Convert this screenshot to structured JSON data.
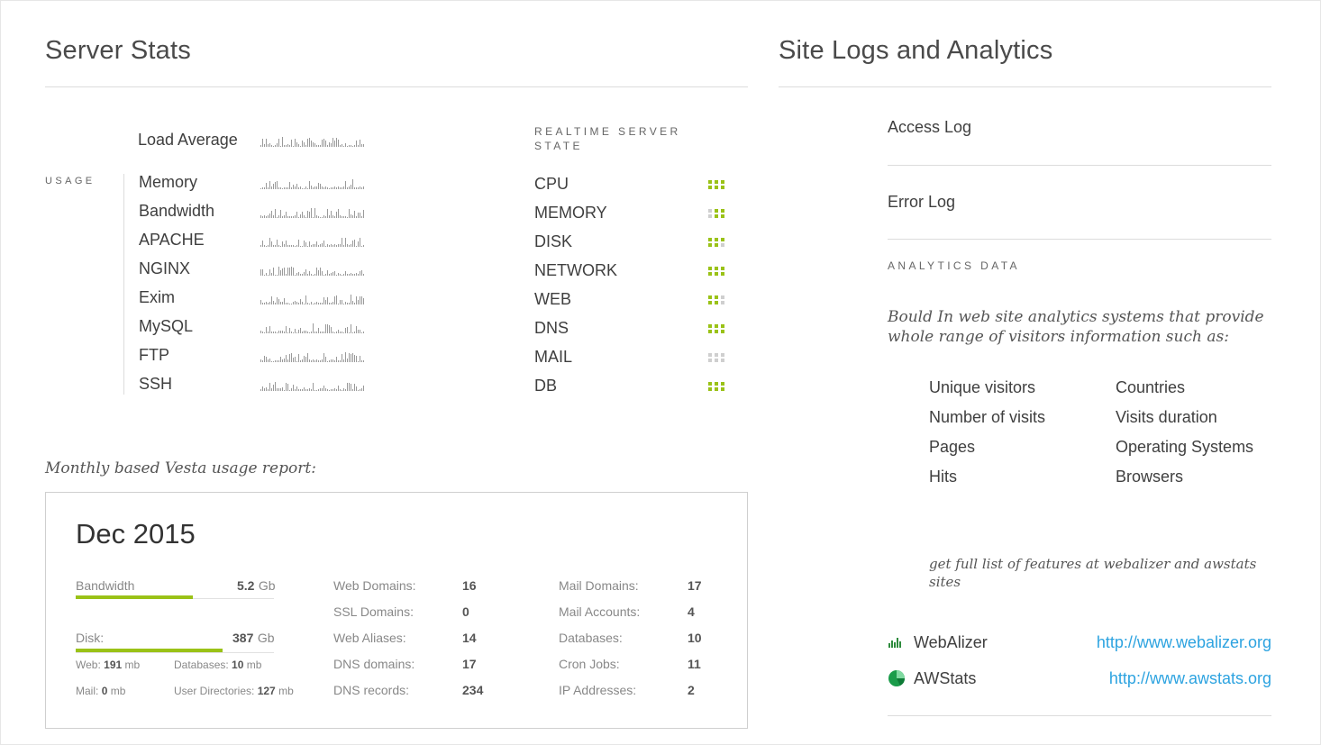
{
  "server_stats": {
    "title": "Server Stats",
    "load_average_label": "Load Average",
    "usage_label": "USAGE",
    "usage_items": [
      "Memory",
      "Bandwidth",
      "APACHE",
      "NGINX",
      "Exim",
      "MySQL",
      "FTP",
      "SSH"
    ],
    "realtime_heading": "REALTIME SERVER STATE",
    "realtime_items": [
      "CPU",
      "MEMORY",
      "DISK",
      "NETWORK",
      "WEB",
      "DNS",
      "MAIL",
      "DB"
    ],
    "colors": {
      "accent": "#9ac217",
      "inactive": "#cfcfcf"
    }
  },
  "monthly": {
    "caption": "Monthly based Vesta usage report:",
    "period": "Dec 2015",
    "bandwidth": {
      "label": "Bandwidth",
      "value": "5.2",
      "unit": "Gb",
      "fill_fraction": 0.59
    },
    "disk": {
      "label": "Disk:",
      "value": "387",
      "unit": "Gb",
      "fill_fraction": 0.74
    },
    "disk_breakdown": {
      "web_label": "Web:",
      "web_value": "191",
      "web_unit": "mb",
      "db_label": "Databases:",
      "db_value": "10",
      "db_unit": "mb",
      "mail_label": "Mail:",
      "mail_value": "0",
      "mail_unit": "mb",
      "userdir_label": "User Directories:",
      "userdir_value": "127",
      "userdir_unit": "mb"
    },
    "stats_left": [
      {
        "label": "Web Domains:",
        "value": "16"
      },
      {
        "label": "SSL Domains:",
        "value": "0"
      },
      {
        "label": "Web Aliases:",
        "value": "14"
      },
      {
        "label": "DNS domains:",
        "value": "17"
      },
      {
        "label": "DNS records:",
        "value": "234"
      }
    ],
    "stats_right": [
      {
        "label": "Mail Domains:",
        "value": "17"
      },
      {
        "label": "Mail Accounts:",
        "value": "4"
      },
      {
        "label": "Databases:",
        "value": "10"
      },
      {
        "label": "Cron Jobs:",
        "value": "11"
      },
      {
        "label": "IP Addresses:",
        "value": "2"
      }
    ]
  },
  "site_logs": {
    "title": "Site Logs and Analytics",
    "access_log": "Access Log",
    "error_log": "Error Log",
    "analytics_heading": "ANALYTICS DATA",
    "analytics_intro": "Bould In web site analytics systems that provide whole range of visitors information such as:",
    "features_left": [
      "Unique visitors",
      "Number of visits",
      "Pages",
      "Hits"
    ],
    "features_right": [
      "Countries",
      "Visits duration",
      "Operating Systems",
      "Browsers"
    ],
    "features_note": "get full list of features at webalizer and awstats sites",
    "tools": [
      {
        "name": "WebAlizer",
        "url": "http://www.webalizer.org",
        "icon": "bar-chart-icon"
      },
      {
        "name": "AWStats",
        "url": "http://www.awstats.org",
        "icon": "pie-chart-icon"
      }
    ]
  }
}
